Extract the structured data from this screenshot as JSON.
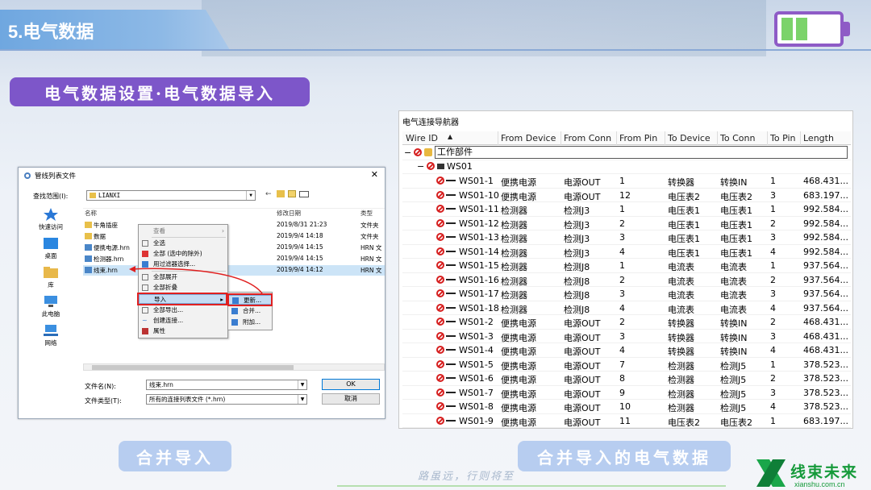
{
  "slide": {
    "title": "5.电气数据",
    "section_badge": "电气数据设置·电气数据导入",
    "caption_left": "合并导入",
    "caption_right": "合并导入的电气数据",
    "slogan": "路虽远，行则将至",
    "logo_text": "线束未来",
    "logo_url": "xianshu.com.cn",
    "colors": {
      "accent_purple": "#7d56c9",
      "title_blue": "#6fa7e0",
      "caption_blue": "#b7cdf0",
      "logo_green": "#159a3a"
    }
  },
  "dialog": {
    "title": "管线列表文件",
    "lookin_label": "查找范围(I):",
    "lookin_value": "LIANXI",
    "places": [
      "快速访问",
      "桌面",
      "库",
      "此电脑",
      "网络"
    ],
    "columns": [
      "名称",
      "修改日期",
      "类型"
    ],
    "files": [
      {
        "name": "牛角插座",
        "date": "2019/8/31 21:23",
        "type": "文件夹"
      },
      {
        "name": "数据",
        "date": "2019/9/4 14:18",
        "type": "文件夹"
      },
      {
        "name": "便携电源.hrn",
        "date": "2019/9/4 14:15",
        "type": "HRN 文"
      },
      {
        "name": "检测器.hrn",
        "date": "2019/9/4 14:15",
        "type": "HRN 文"
      },
      {
        "name": "线束.hrn",
        "date": "2019/9/4 14:12",
        "type": "HRN 文"
      }
    ],
    "filename_label": "文件名(N):",
    "filename_value": "线束.hrn",
    "filetype_label": "文件类型(T):",
    "filetype_value": "所有的连接列表文件 (*.hrn)",
    "ok_label": "OK",
    "cancel_label": "取消"
  },
  "context_menu": {
    "items": [
      "查看",
      "全选",
      "全部 (选中的除外)",
      "用过滤器选择...",
      "全部展开",
      "全部折叠",
      "导入",
      "全部导出...",
      "创建连接...",
      "属性"
    ],
    "submenu": [
      "更新...",
      "合并...",
      "附加..."
    ]
  },
  "navigator": {
    "title": "电气连接导航器",
    "columns": [
      "Wire ID",
      "From Device",
      "From Conn",
      "From Pin",
      "To Device",
      "To Conn",
      "To Pin",
      "Length"
    ],
    "root": "工作部件",
    "group": "WS01",
    "rows": [
      [
        "WS01-1",
        "便携电源",
        "电源OUT",
        "1",
        "转换器",
        "转换IN",
        "1",
        "468.431..."
      ],
      [
        "WS01-10",
        "便携电源",
        "电源OUT",
        "12",
        "电压表2",
        "电压表2",
        "3",
        "683.197..."
      ],
      [
        "WS01-11",
        "检测器",
        "检测J3",
        "1",
        "电压表1",
        "电压表1",
        "1",
        "992.584..."
      ],
      [
        "WS01-12",
        "检测器",
        "检测J3",
        "2",
        "电压表1",
        "电压表1",
        "2",
        "992.584..."
      ],
      [
        "WS01-13",
        "检测器",
        "检测J3",
        "3",
        "电压表1",
        "电压表1",
        "3",
        "992.584..."
      ],
      [
        "WS01-14",
        "检测器",
        "检测J3",
        "4",
        "电压表1",
        "电压表1",
        "4",
        "992.584..."
      ],
      [
        "WS01-15",
        "检测器",
        "检测J8",
        "1",
        "电流表",
        "电流表",
        "1",
        "937.564..."
      ],
      [
        "WS01-16",
        "检测器",
        "检测J8",
        "2",
        "电流表",
        "电流表",
        "2",
        "937.564..."
      ],
      [
        "WS01-17",
        "检测器",
        "检测J8",
        "3",
        "电流表",
        "电流表",
        "3",
        "937.564..."
      ],
      [
        "WS01-18",
        "检测器",
        "检测J8",
        "4",
        "电流表",
        "电流表",
        "4",
        "937.564..."
      ],
      [
        "WS01-2",
        "便携电源",
        "电源OUT",
        "2",
        "转换器",
        "转换IN",
        "2",
        "468.431..."
      ],
      [
        "WS01-3",
        "便携电源",
        "电源OUT",
        "3",
        "转换器",
        "转换IN",
        "3",
        "468.431..."
      ],
      [
        "WS01-4",
        "便携电源",
        "电源OUT",
        "4",
        "转换器",
        "转换IN",
        "4",
        "468.431..."
      ],
      [
        "WS01-5",
        "便携电源",
        "电源OUT",
        "7",
        "检测器",
        "检测J5",
        "1",
        "378.523..."
      ],
      [
        "WS01-6",
        "便携电源",
        "电源OUT",
        "8",
        "检测器",
        "检测J5",
        "2",
        "378.523..."
      ],
      [
        "WS01-7",
        "便携电源",
        "电源OUT",
        "9",
        "检测器",
        "检测J5",
        "3",
        "378.523..."
      ],
      [
        "WS01-8",
        "便携电源",
        "电源OUT",
        "10",
        "检测器",
        "检测J5",
        "4",
        "378.523..."
      ],
      [
        "WS01-9",
        "便携电源",
        "电源OUT",
        "11",
        "电压表2",
        "电压表2",
        "1",
        "683.197..."
      ]
    ]
  }
}
